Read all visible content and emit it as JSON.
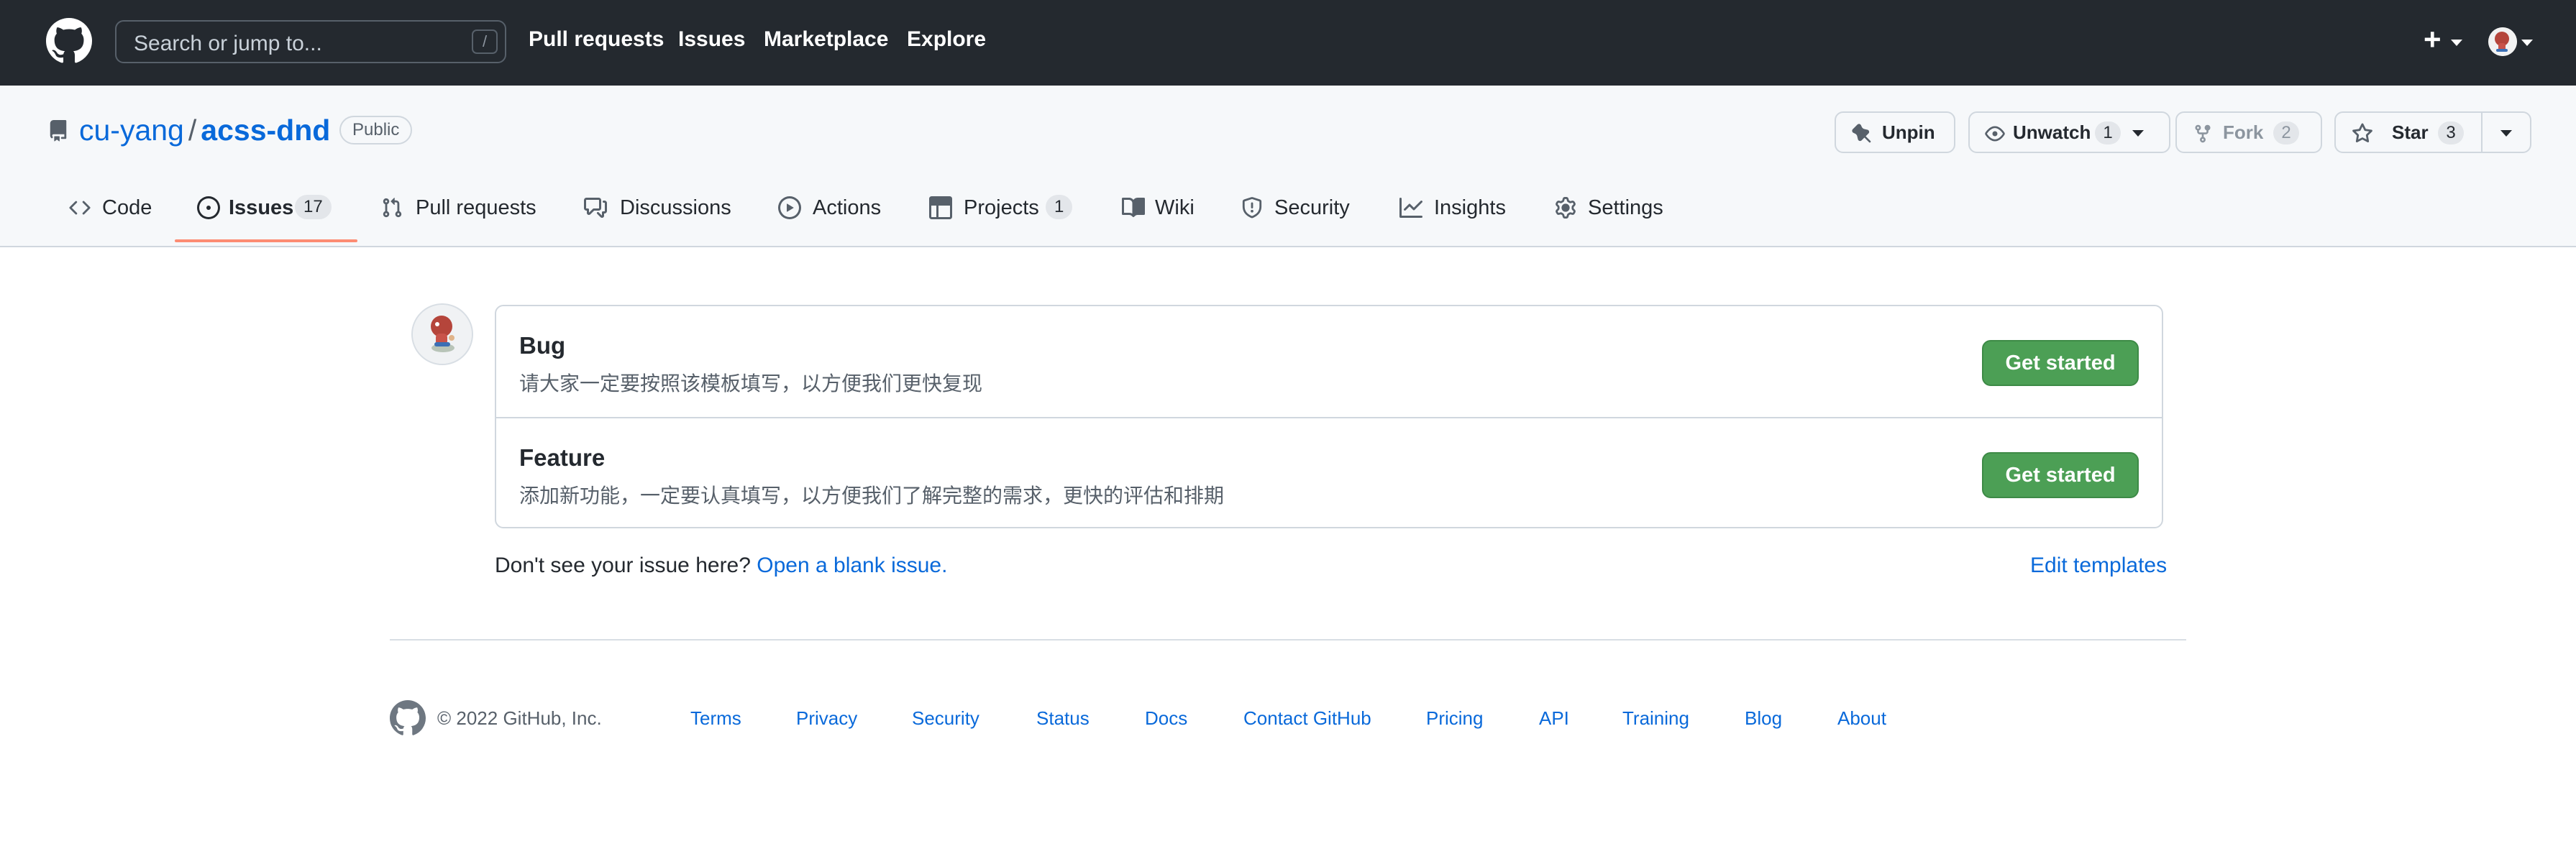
{
  "header": {
    "search_placeholder": "Search or jump to...",
    "search_shortcut": "/",
    "nav": [
      "Pull requests",
      "Issues",
      "Marketplace",
      "Explore"
    ],
    "plus_label": "+"
  },
  "repo": {
    "owner": "cu-yang",
    "separator": "/",
    "name": "acss-dnd",
    "visibility": "Public"
  },
  "actions": {
    "unpin": "Unpin",
    "watch": "Unwatch",
    "watch_count": "1",
    "fork": "Fork",
    "fork_count": "2",
    "star": "Star",
    "star_count": "3"
  },
  "tabs": [
    {
      "label": "Code",
      "icon": "code-icon"
    },
    {
      "label": "Issues",
      "icon": "issue-opened-icon",
      "count": "17",
      "selected": true
    },
    {
      "label": "Pull requests",
      "icon": "git-pull-request-icon"
    },
    {
      "label": "Discussions",
      "icon": "comment-discussion-icon"
    },
    {
      "label": "Actions",
      "icon": "play-icon"
    },
    {
      "label": "Projects",
      "icon": "table-icon",
      "count": "1"
    },
    {
      "label": "Wiki",
      "icon": "book-icon"
    },
    {
      "label": "Security",
      "icon": "shield-icon"
    },
    {
      "label": "Insights",
      "icon": "graph-icon"
    },
    {
      "label": "Settings",
      "icon": "gear-icon"
    }
  ],
  "templates": [
    {
      "title": "Bug",
      "description": "请大家一定要按照该模板填写，以方便我们更快复现",
      "button": "Get started"
    },
    {
      "title": "Feature",
      "description": "添加新功能，一定要认真填写，以方便我们了解完整的需求，更快的评估和排期",
      "button": "Get started"
    }
  ],
  "blank_issue": {
    "prompt": "Don't see your issue here?",
    "link": "Open a blank issue.",
    "edit_templates": "Edit templates"
  },
  "footer": {
    "copyright": "© 2022 GitHub, Inc.",
    "links": [
      "Terms",
      "Privacy",
      "Security",
      "Status",
      "Docs",
      "Contact GitHub",
      "Pricing",
      "API",
      "Training",
      "Blog",
      "About"
    ]
  },
  "colors": {
    "header_bg": "#24292f",
    "link": "#0969da",
    "primary_button": "#4c9f55",
    "selected_tab_underline": "#fd8c73"
  }
}
